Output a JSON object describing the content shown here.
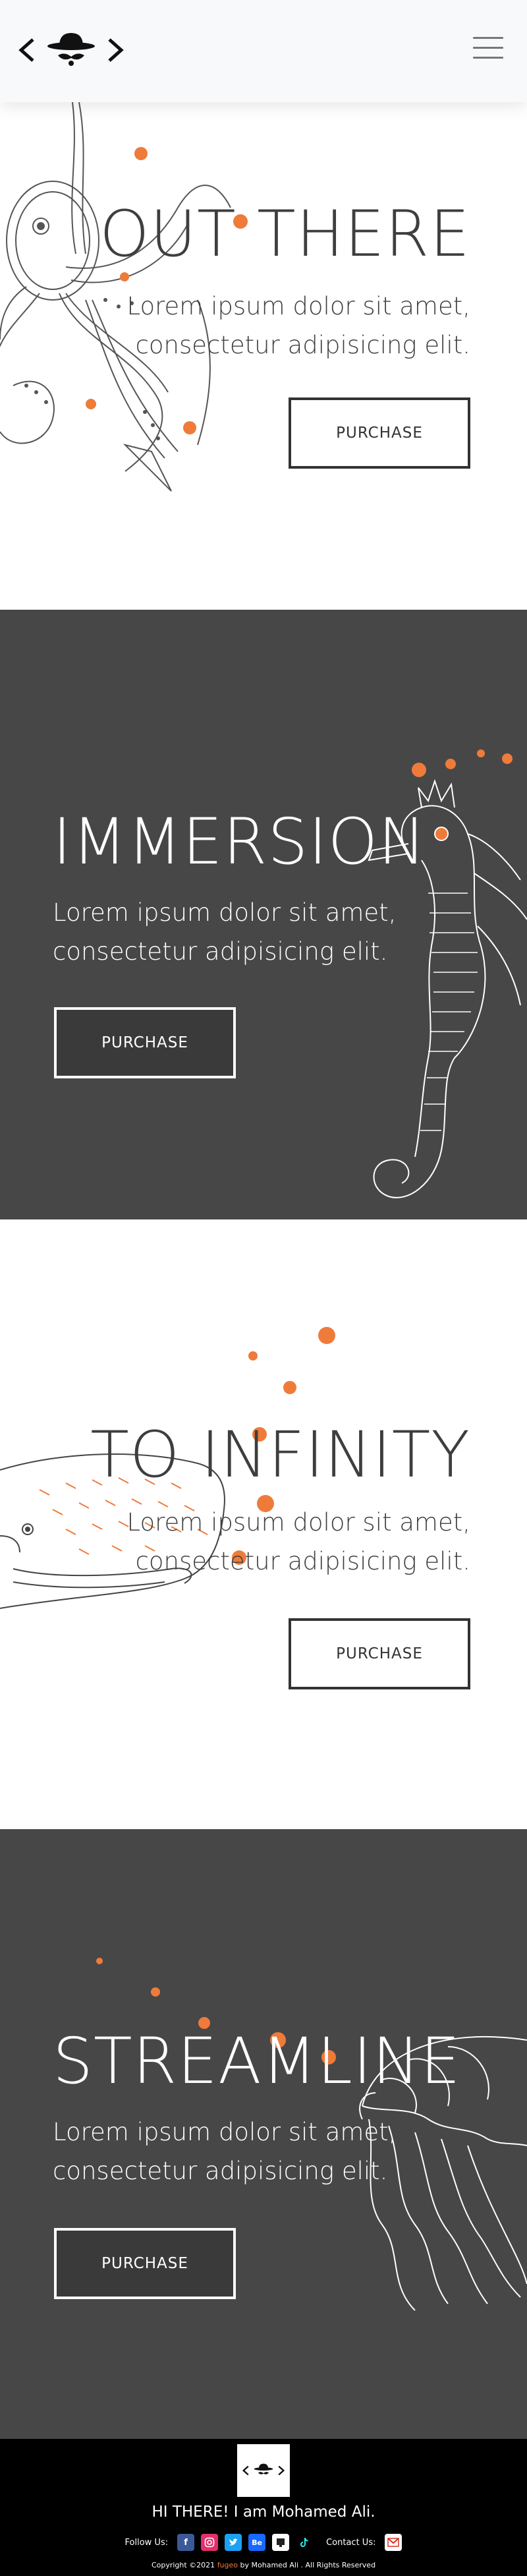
{
  "nav": {
    "logo_icon": "hat-mustache-logo-icon",
    "menu_icon": "hamburger-menu-icon"
  },
  "sections": [
    {
      "title": "OUT THERE",
      "description": "Lorem ipsum dolor sit amet, consectetur adipisicing elit.",
      "button": "PURCHASE",
      "illustration": "octopus-illustration"
    },
    {
      "title": "IMMERSION",
      "description": "Lorem ipsum dolor sit amet, consectetur adipisicing elit.",
      "button": "PURCHASE",
      "illustration": "seahorse-illustration"
    },
    {
      "title": "TO INFINITY",
      "description": "Lorem ipsum dolor sit amet, consectetur adipisicing elit.",
      "button": "PURCHASE",
      "illustration": "whale-illustration"
    },
    {
      "title": "STREAMLINE",
      "description": "Lorem ipsum dolor sit amet, consectetur adipisicing elit.",
      "button": "PURCHASE",
      "illustration": "jellyfish-illustration"
    }
  ],
  "footer": {
    "greeting": "HI THERE! I am Mohamed Ali.",
    "follow_label": "Follow Us:",
    "contact_label": "Contact Us:",
    "social": [
      "facebook-icon",
      "instagram-icon",
      "twitter-icon",
      "behance-icon",
      "github-icon",
      "tiktok-icon"
    ],
    "copyright_prefix": "Copyright ©2021",
    "brand": "fugeo",
    "copyright_suffix": "by Mohamed Ali . All Rights Reserved"
  },
  "colors": {
    "accent": "#ef7b3a",
    "dark_bg": "#474747",
    "nav_bg": "#f8f9fa",
    "footer_bg": "#000000"
  }
}
